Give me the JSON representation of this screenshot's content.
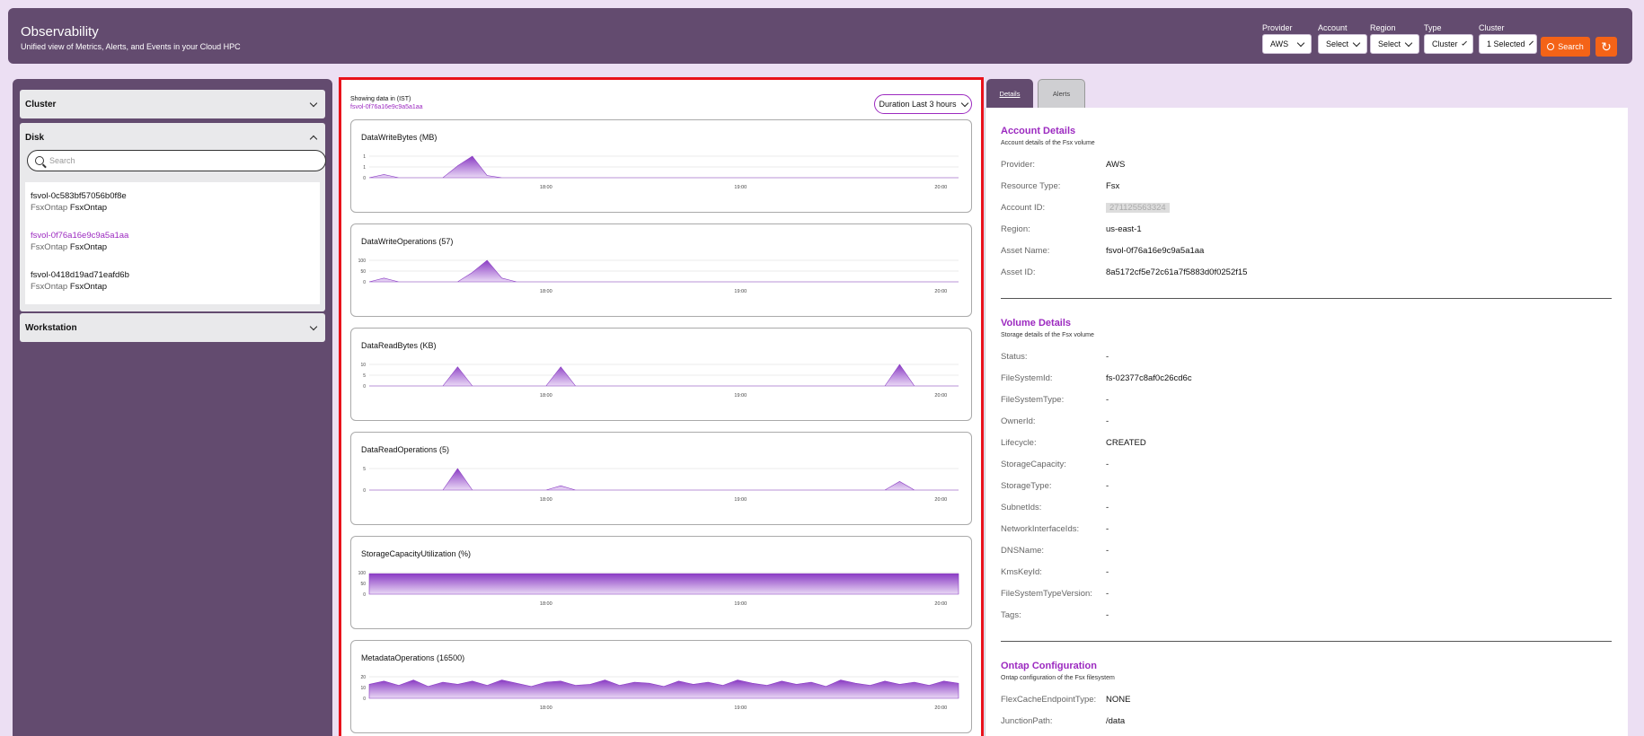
{
  "header": {
    "title": "Observability",
    "subtitle": "Unified view of Metrics, Alerts, and Events in your Cloud HPC"
  },
  "filters": [
    {
      "label": "Provider",
      "value": "AWS"
    },
    {
      "label": "Account",
      "value": "Select"
    },
    {
      "label": "Region",
      "value": "Select"
    },
    {
      "label": "Type",
      "value": "Cluster"
    },
    {
      "label": "Cluster",
      "value": "1 Selected"
    }
  ],
  "search_button": "Search",
  "sidebar": {
    "cluster_label": "Cluster",
    "disk_label": "Disk",
    "search_placeholder": "Search",
    "workstation_label": "Workstation",
    "disks": [
      {
        "name": "fsvol-0c583bf57056b0f8e",
        "type_label": "FsxOntap",
        "type_value": "FsxOntap",
        "selected": false
      },
      {
        "name": "fsvol-0f76a16e9c9a5a1aa",
        "type_label": "FsxOntap",
        "type_value": "FsxOntap",
        "selected": true
      },
      {
        "name": "fsvol-0418d19ad71eafd6b",
        "type_label": "FsxOntap",
        "type_value": "FsxOntap",
        "selected": false
      }
    ]
  },
  "center": {
    "showing": "Showing data in (IST)",
    "asset": "fsvol-0f76a16e9c9a5a1aa",
    "duration": "Duration  Last 3 hours",
    "charts": [
      {
        "title": "DataWriteBytes  (MB)"
      },
      {
        "title": "DataWriteOperations  (57)"
      },
      {
        "title": "DataReadBytes  (KB)"
      },
      {
        "title": "DataReadOperations  (5)"
      },
      {
        "title": "StorageCapacityUtilization  (%)"
      },
      {
        "title": "MetadataOperations  (16500)"
      }
    ]
  },
  "chart_data": [
    {
      "type": "area",
      "title": "DataWriteBytes  (MB)",
      "x_ticks": [
        "18:00",
        "19:00",
        "20:00"
      ],
      "y_ticks": [
        "1",
        "1",
        "0"
      ],
      "series": [
        {
          "values": [
            0,
            0.15,
            0,
            0,
            0,
            0,
            0.55,
            1,
            0.1,
            0,
            0,
            0,
            0,
            0,
            0,
            0,
            0,
            0,
            0,
            0,
            0,
            0,
            0,
            0,
            0,
            0,
            0,
            0,
            0,
            0,
            0,
            0,
            0,
            0,
            0,
            0,
            0,
            0,
            0,
            0,
            0
          ]
        }
      ]
    },
    {
      "type": "area",
      "title": "DataWriteOperations  (57)",
      "x_ticks": [
        "18:00",
        "19:00",
        "20:00"
      ],
      "y_ticks": [
        "100",
        "50",
        "0"
      ],
      "series": [
        {
          "values": [
            0,
            10,
            0,
            0,
            0,
            0,
            0,
            25,
            57,
            10,
            0,
            0,
            0,
            0,
            0,
            0,
            0,
            0,
            0,
            0,
            0,
            0,
            0,
            0,
            0,
            0,
            0,
            0,
            0,
            0,
            0,
            0,
            0,
            0,
            0,
            0,
            0,
            0,
            0,
            0,
            0
          ]
        }
      ]
    },
    {
      "type": "area",
      "title": "DataReadBytes  (KB)",
      "x_ticks": [
        "18:00",
        "19:00",
        "20:00"
      ],
      "y_ticks": [
        "10",
        "5",
        "0"
      ],
      "series": [
        {
          "values": [
            0,
            0,
            0,
            0,
            0,
            0,
            8,
            0,
            0,
            0,
            0,
            0,
            0,
            8,
            0,
            0,
            0,
            0,
            0,
            0,
            0,
            0,
            0,
            0,
            0,
            0,
            0,
            0,
            0,
            0,
            0,
            0,
            0,
            0,
            0,
            0,
            9,
            0,
            0,
            0,
            0
          ]
        }
      ]
    },
    {
      "type": "area",
      "title": "DataReadOperations  (5)",
      "x_ticks": [
        "18:00",
        "19:00",
        "20:00"
      ],
      "y_ticks": [
        "5",
        "0"
      ],
      "series": [
        {
          "values": [
            0,
            0,
            0,
            0,
            0,
            0,
            5,
            0,
            0,
            0,
            0,
            0,
            0,
            1,
            0,
            0,
            0,
            0,
            0,
            0,
            0,
            0,
            0,
            0,
            0,
            0,
            0,
            0,
            0,
            0,
            0,
            0,
            0,
            0,
            0,
            0,
            2,
            0,
            0,
            0,
            0
          ]
        }
      ]
    },
    {
      "type": "area",
      "title": "StorageCapacityUtilization  (%)",
      "x_ticks": [
        "18:00",
        "19:00",
        "20:00"
      ],
      "y_ticks": [
        "100",
        "50",
        "0"
      ],
      "series": [
        {
          "values": [
            95,
            95,
            95,
            95,
            95,
            95,
            95,
            95,
            95,
            95,
            95,
            95,
            95,
            95,
            95,
            95,
            95,
            95,
            95,
            95,
            95,
            95,
            95,
            95,
            95,
            95,
            95,
            95,
            95,
            95,
            95,
            95,
            95,
            95,
            95,
            95,
            95,
            95,
            95,
            95,
            95
          ]
        }
      ]
    },
    {
      "type": "area",
      "title": "MetadataOperations  (16500)",
      "x_ticks": [
        "18:00",
        "19:00",
        "20:00"
      ],
      "y_ticks": [
        "20",
        "10",
        "0"
      ],
      "series": [
        {
          "values": [
            13,
            16,
            12,
            17,
            11,
            15,
            13,
            16,
            12,
            17,
            14,
            11,
            15,
            16,
            12,
            13,
            17,
            12,
            15,
            14,
            11,
            16,
            13,
            15,
            12,
            17,
            14,
            12,
            16,
            13,
            15,
            11,
            17,
            14,
            12,
            16,
            13,
            15,
            12,
            16,
            14
          ]
        }
      ]
    }
  ],
  "tabs": {
    "details": "Details",
    "alerts": "Alerts"
  },
  "account": {
    "title": "Account Details",
    "subtitle": "Account details of the Fsx volume",
    "rows": [
      {
        "k": "Provider:",
        "v": "AWS"
      },
      {
        "k": "Resource Type:",
        "v": "Fsx"
      },
      {
        "k": "Account ID:",
        "v": "271125563324"
      },
      {
        "k": "Region:",
        "v": "us-east-1"
      },
      {
        "k": "Asset Name:",
        "v": "fsvol-0f76a16e9c9a5a1aa"
      },
      {
        "k": "Asset ID:",
        "v": "8a5172cf5e72c61a7f5883d0f0252f15"
      }
    ]
  },
  "volume": {
    "title": "Volume Details",
    "subtitle": "Storage details of the Fsx volume",
    "rows": [
      {
        "k": "Status:",
        "v": "-"
      },
      {
        "k": "FileSystemId:",
        "v": "fs-02377c8af0c26cd6c"
      },
      {
        "k": "FileSystemType:",
        "v": "-"
      },
      {
        "k": "OwnerId:",
        "v": "-"
      },
      {
        "k": "Lifecycle:",
        "v": "CREATED"
      },
      {
        "k": "StorageCapacity:",
        "v": "-"
      },
      {
        "k": "StorageType:",
        "v": "-"
      },
      {
        "k": "SubnetIds:",
        "v": "-"
      },
      {
        "k": "NetworkInterfaceIds:",
        "v": "-"
      },
      {
        "k": "DNSName:",
        "v": "-"
      },
      {
        "k": "KmsKeyId:",
        "v": "-"
      },
      {
        "k": "FileSystemTypeVersion:",
        "v": "-"
      },
      {
        "k": "Tags:",
        "v": "-"
      }
    ]
  },
  "ontap": {
    "title": "Ontap Configuration",
    "subtitle": "Ontap configuration of the Fsx filesystem",
    "rows": [
      {
        "k": "FlexCacheEndpointType:",
        "v": "NONE"
      },
      {
        "k": "JunctionPath:",
        "v": "/data"
      }
    ]
  },
  "colors": {
    "header": "#634b6f",
    "accent": "#9c2ac0",
    "orange": "#f46317",
    "highlight": "#e8121b",
    "area": "#8a3cc4"
  }
}
